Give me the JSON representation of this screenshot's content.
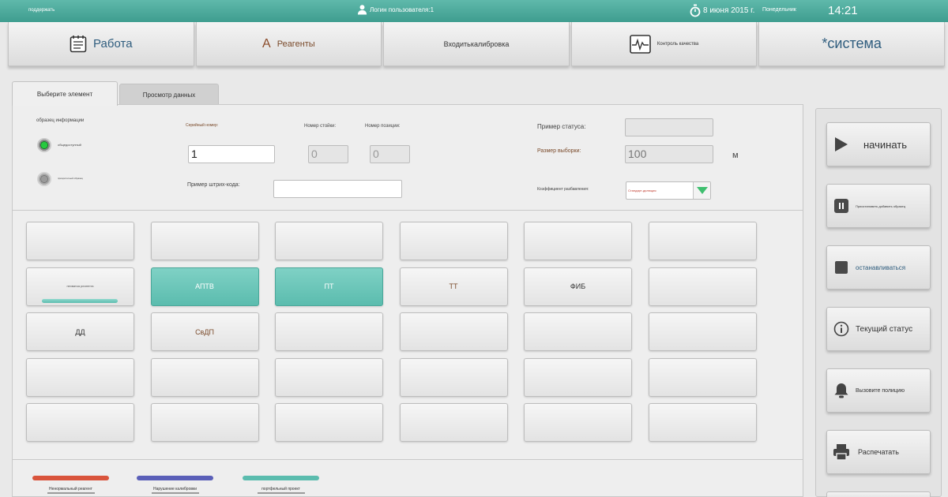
{
  "topbar": {
    "support": "поддержать",
    "user": "Логин пользователя:1",
    "date": "8 июня 2015 г.",
    "weekday": "Понедельник",
    "time": "14:21"
  },
  "nav": {
    "work": "Работа",
    "reagents_glyph": "A",
    "reagents": "Реагенты",
    "calibration": "Входитькалибровка",
    "quality": "Контроль качества",
    "system": "*система"
  },
  "tabs": {
    "select_element": "Выберите элемент",
    "view_data": "Просмотр данных"
  },
  "form": {
    "sample_info": "образец информации",
    "status_green": "общедоступный",
    "status_gray": "приоритетный образец",
    "serial_label": "Серийный номер:",
    "serial_value": "1",
    "rack_label": "Номер стойки:",
    "rack_value": "0",
    "position_label": "Номер позиции:",
    "position_value": "0",
    "status_label": "Пример статуса:",
    "status_value": "",
    "volume_label": "Размер выборки:",
    "volume_value": "100",
    "volume_unit": "м",
    "barcode_label": "Пример штрих-кода:",
    "barcode_value": "",
    "dilution_label": "Коэффициент разбавления:",
    "dilution_value": "Стандарт-дилюция"
  },
  "grid": {
    "r2c1_small": "нехватка реагента",
    "aptv": "АПТВ",
    "pt": "ПТ",
    "tt": "ТТ",
    "fib": "ФИБ",
    "dd": "ДД",
    "fdp": "СвДП"
  },
  "legend": {
    "red": "Ненормальный реагент",
    "blue": "Нарушение калибровки",
    "teal": "портфельный проект"
  },
  "controls": {
    "start": "начинать",
    "pause": "Приостановить добавить образец",
    "stop": "останавливаться",
    "status": "Текущий статус",
    "call": "Вызовите полицию",
    "print": "Распечатать"
  },
  "colors": {
    "accent": "#5bbcae",
    "legend_red": "#d9543c",
    "legend_blue": "#5a5fb8",
    "legend_teal": "#5bbcae"
  }
}
